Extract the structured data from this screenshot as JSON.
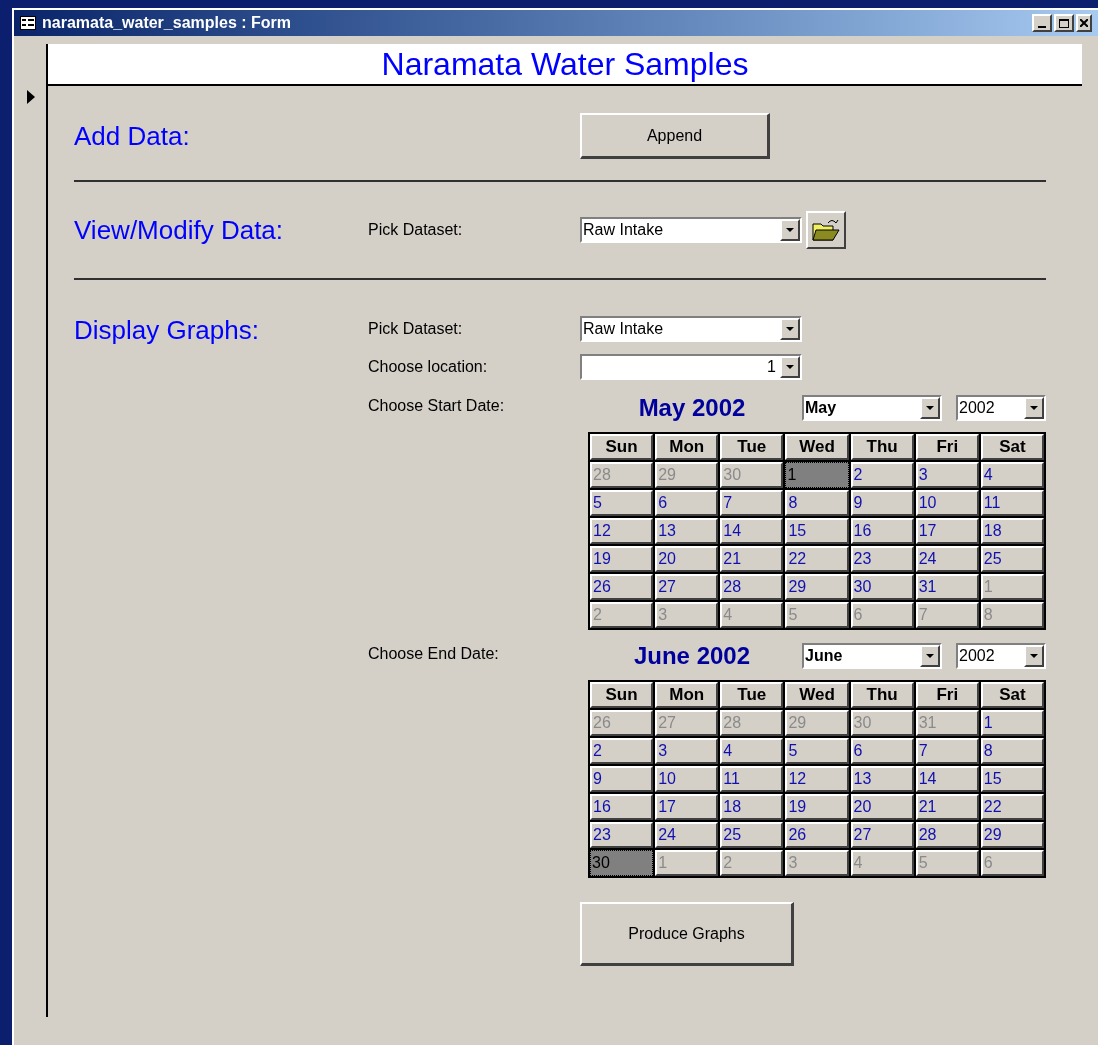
{
  "window": {
    "title": "naramata_water_samples : Form"
  },
  "form_title": "Naramata Water Samples",
  "add_data": {
    "heading": "Add Data:",
    "button": "Append"
  },
  "view_modify": {
    "heading": "View/Modify Data:",
    "label": "Pick Dataset:",
    "value": "Raw Intake"
  },
  "display_graphs": {
    "heading": "Display Graphs:",
    "dataset_label": "Pick Dataset:",
    "dataset_value": "Raw Intake",
    "location_label": "Choose location:",
    "location_value": "1"
  },
  "calendars": [
    {
      "label": "Choose Start Date:",
      "title": "May 2002",
      "month": "May",
      "year": "2002",
      "weekdays": [
        "Sun",
        "Mon",
        "Tue",
        "Wed",
        "Thu",
        "Fri",
        "Sat"
      ],
      "weeks": [
        [
          {
            "day": "28",
            "other": true,
            "selected": false
          },
          {
            "day": "29",
            "other": true,
            "selected": false
          },
          {
            "day": "30",
            "other": true,
            "selected": false
          },
          {
            "day": "1",
            "other": false,
            "selected": true
          },
          {
            "day": "2",
            "other": false,
            "selected": false
          },
          {
            "day": "3",
            "other": false,
            "selected": false
          },
          {
            "day": "4",
            "other": false,
            "selected": false
          }
        ],
        [
          {
            "day": "5",
            "other": false,
            "selected": false
          },
          {
            "day": "6",
            "other": false,
            "selected": false
          },
          {
            "day": "7",
            "other": false,
            "selected": false
          },
          {
            "day": "8",
            "other": false,
            "selected": false
          },
          {
            "day": "9",
            "other": false,
            "selected": false
          },
          {
            "day": "10",
            "other": false,
            "selected": false
          },
          {
            "day": "11",
            "other": false,
            "selected": false
          }
        ],
        [
          {
            "day": "12",
            "other": false,
            "selected": false
          },
          {
            "day": "13",
            "other": false,
            "selected": false
          },
          {
            "day": "14",
            "other": false,
            "selected": false
          },
          {
            "day": "15",
            "other": false,
            "selected": false
          },
          {
            "day": "16",
            "other": false,
            "selected": false
          },
          {
            "day": "17",
            "other": false,
            "selected": false
          },
          {
            "day": "18",
            "other": false,
            "selected": false
          }
        ],
        [
          {
            "day": "19",
            "other": false,
            "selected": false
          },
          {
            "day": "20",
            "other": false,
            "selected": false
          },
          {
            "day": "21",
            "other": false,
            "selected": false
          },
          {
            "day": "22",
            "other": false,
            "selected": false
          },
          {
            "day": "23",
            "other": false,
            "selected": false
          },
          {
            "day": "24",
            "other": false,
            "selected": false
          },
          {
            "day": "25",
            "other": false,
            "selected": false
          }
        ],
        [
          {
            "day": "26",
            "other": false,
            "selected": false
          },
          {
            "day": "27",
            "other": false,
            "selected": false
          },
          {
            "day": "28",
            "other": false,
            "selected": false
          },
          {
            "day": "29",
            "other": false,
            "selected": false
          },
          {
            "day": "30",
            "other": false,
            "selected": false
          },
          {
            "day": "31",
            "other": false,
            "selected": false
          },
          {
            "day": "1",
            "other": true,
            "selected": false
          }
        ],
        [
          {
            "day": "2",
            "other": true,
            "selected": false
          },
          {
            "day": "3",
            "other": true,
            "selected": false
          },
          {
            "day": "4",
            "other": true,
            "selected": false
          },
          {
            "day": "5",
            "other": true,
            "selected": false
          },
          {
            "day": "6",
            "other": true,
            "selected": false
          },
          {
            "day": "7",
            "other": true,
            "selected": false
          },
          {
            "day": "8",
            "other": true,
            "selected": false
          }
        ]
      ]
    },
    {
      "label": "Choose End Date:",
      "title": "June 2002",
      "month": "June",
      "year": "2002",
      "weekdays": [
        "Sun",
        "Mon",
        "Tue",
        "Wed",
        "Thu",
        "Fri",
        "Sat"
      ],
      "weeks": [
        [
          {
            "day": "26",
            "other": true,
            "selected": false
          },
          {
            "day": "27",
            "other": true,
            "selected": false
          },
          {
            "day": "28",
            "other": true,
            "selected": false
          },
          {
            "day": "29",
            "other": true,
            "selected": false
          },
          {
            "day": "30",
            "other": true,
            "selected": false
          },
          {
            "day": "31",
            "other": true,
            "selected": false
          },
          {
            "day": "1",
            "other": false,
            "selected": false
          }
        ],
        [
          {
            "day": "2",
            "other": false,
            "selected": false
          },
          {
            "day": "3",
            "other": false,
            "selected": false
          },
          {
            "day": "4",
            "other": false,
            "selected": false
          },
          {
            "day": "5",
            "other": false,
            "selected": false
          },
          {
            "day": "6",
            "other": false,
            "selected": false
          },
          {
            "day": "7",
            "other": false,
            "selected": false
          },
          {
            "day": "8",
            "other": false,
            "selected": false
          }
        ],
        [
          {
            "day": "9",
            "other": false,
            "selected": false
          },
          {
            "day": "10",
            "other": false,
            "selected": false
          },
          {
            "day": "11",
            "other": false,
            "selected": false
          },
          {
            "day": "12",
            "other": false,
            "selected": false
          },
          {
            "day": "13",
            "other": false,
            "selected": false
          },
          {
            "day": "14",
            "other": false,
            "selected": false
          },
          {
            "day": "15",
            "other": false,
            "selected": false
          }
        ],
        [
          {
            "day": "16",
            "other": false,
            "selected": false
          },
          {
            "day": "17",
            "other": false,
            "selected": false
          },
          {
            "day": "18",
            "other": false,
            "selected": false
          },
          {
            "day": "19",
            "other": false,
            "selected": false
          },
          {
            "day": "20",
            "other": false,
            "selected": false
          },
          {
            "day": "21",
            "other": false,
            "selected": false
          },
          {
            "day": "22",
            "other": false,
            "selected": false
          }
        ],
        [
          {
            "day": "23",
            "other": false,
            "selected": false
          },
          {
            "day": "24",
            "other": false,
            "selected": false
          },
          {
            "day": "25",
            "other": false,
            "selected": false
          },
          {
            "day": "26",
            "other": false,
            "selected": false
          },
          {
            "day": "27",
            "other": false,
            "selected": false
          },
          {
            "day": "28",
            "other": false,
            "selected": false
          },
          {
            "day": "29",
            "other": false,
            "selected": false
          }
        ],
        [
          {
            "day": "30",
            "other": false,
            "selected": true
          },
          {
            "day": "1",
            "other": true,
            "selected": false
          },
          {
            "day": "2",
            "other": true,
            "selected": false
          },
          {
            "day": "3",
            "other": true,
            "selected": false
          },
          {
            "day": "4",
            "other": true,
            "selected": false
          },
          {
            "day": "5",
            "other": true,
            "selected": false
          },
          {
            "day": "6",
            "other": true,
            "selected": false
          }
        ]
      ]
    }
  ],
  "produce_button": "Produce Graphs"
}
